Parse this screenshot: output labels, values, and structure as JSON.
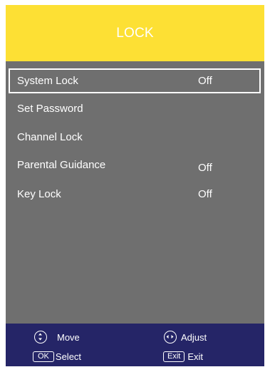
{
  "header": {
    "title": "LOCK"
  },
  "menu": {
    "items": [
      {
        "label": "System Lock",
        "value": "Off",
        "selected": true
      },
      {
        "label": "Set Password",
        "value": ""
      },
      {
        "label": "Channel Lock",
        "value": ""
      },
      {
        "label": "Parental Guidance",
        "value": "Off"
      },
      {
        "label": "Key Lock",
        "value": "Off"
      }
    ]
  },
  "footer": {
    "move_label": "Move",
    "adjust_label": "Adjust",
    "ok_key": "OK",
    "select_label": "Select",
    "exit_key": "Exit",
    "exit_label": "Exit"
  },
  "icons": {
    "move": "up-down-arrows-icon",
    "adjust": "left-right-arrows-icon"
  },
  "colors": {
    "header_bg": "#fde034",
    "body_bg": "#6f6f6f",
    "footer_bg": "#252567",
    "text": "#ffffff"
  }
}
